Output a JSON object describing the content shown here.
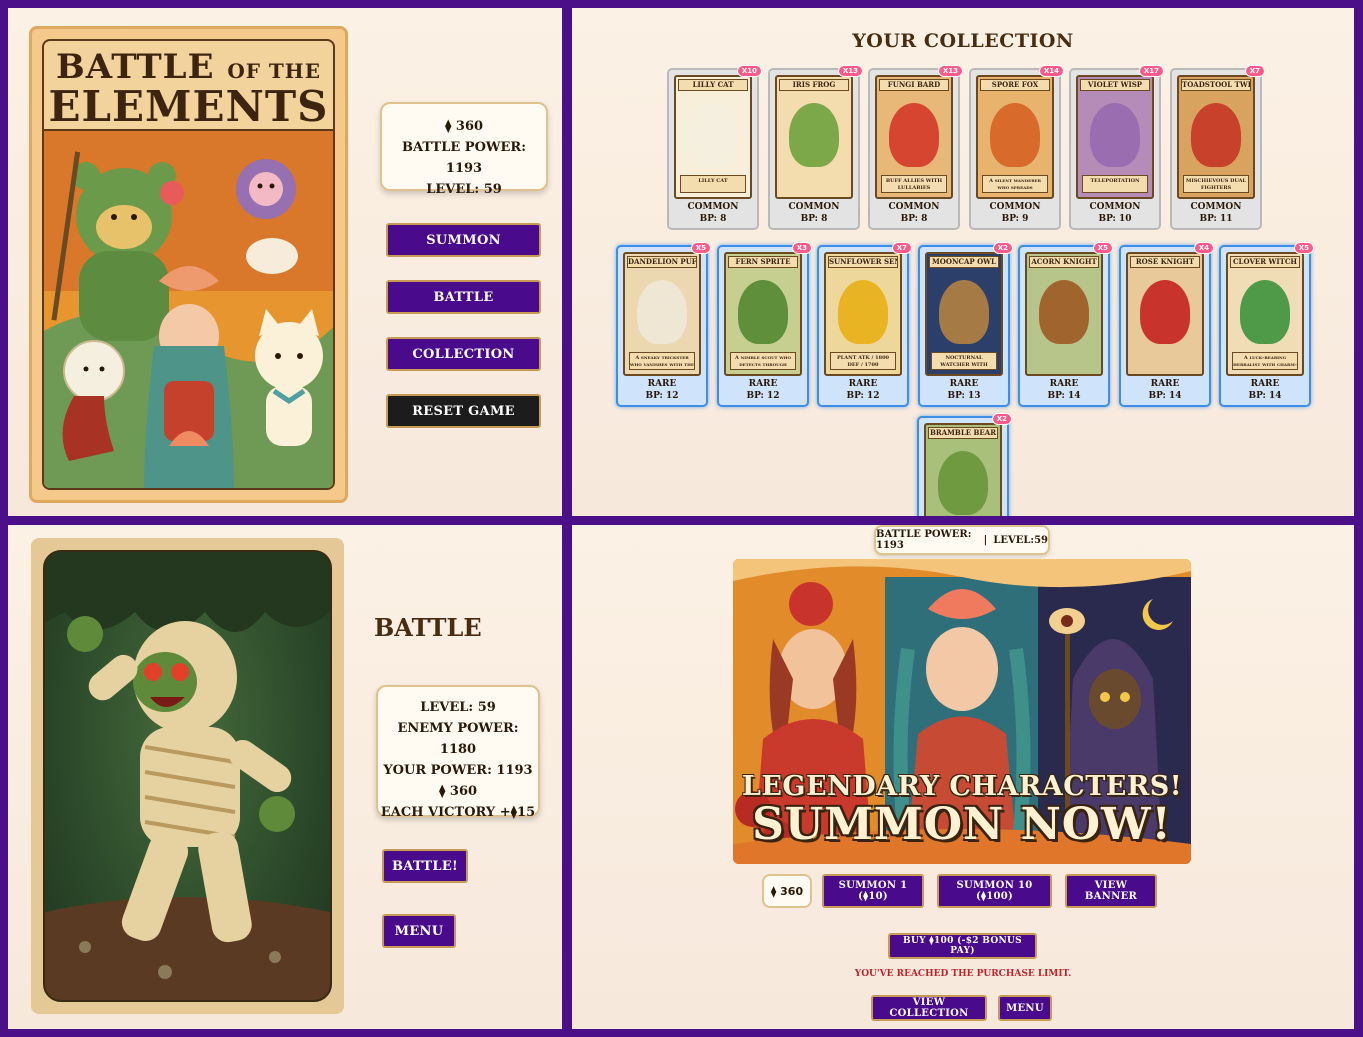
{
  "menu": {
    "title_line1": "BATTLE",
    "title_of_the": "OF THE",
    "title_line2": "ELEMENTS",
    "gems": "⧫ 360",
    "battle_power": "BATTLE POWER: 1193",
    "level": "LEVEL: 59",
    "buttons": {
      "summon": "SUMMON",
      "battle": "BATTLE",
      "collection": "COLLECTION",
      "reset": "RESET GAME"
    }
  },
  "collection": {
    "title": "YOUR COLLECTION",
    "cards": [
      {
        "name": "LILLY CAT",
        "rarity": "COMMON",
        "bp": "BP: 8",
        "count": "X10",
        "caption": "LILLY CAT",
        "color": "#f7efd9",
        "fig": "#f5efe0"
      },
      {
        "name": "IRIS FROG",
        "rarity": "COMMON",
        "bp": "BP: 8",
        "count": "X13",
        "caption": "",
        "color": "#f3dcae",
        "fig": "#7da84a"
      },
      {
        "name": "FUNGI BARD",
        "rarity": "COMMON",
        "bp": "BP: 8",
        "count": "X13",
        "caption": "BUFF ALLIES WITH LULLABIES",
        "color": "#e8b879",
        "fig": "#d6452f"
      },
      {
        "name": "SPORE FOX",
        "rarity": "COMMON",
        "bp": "BP: 9",
        "count": "X14",
        "caption": "A silent wanderer who spreads enchantment spores.",
        "color": "#e7b36d",
        "fig": "#d86b2c"
      },
      {
        "name": "VIOLET WISP",
        "rarity": "COMMON",
        "bp": "BP: 10",
        "count": "X17",
        "caption": "TELEPORTATION",
        "color": "#b58bb8",
        "fig": "#9a6db0"
      },
      {
        "name": "TOADSTOOL TWINS",
        "rarity": "COMMON",
        "bp": "BP: 11",
        "count": "X7",
        "caption": "MISCHIEVOUS DUAL FIGHTERS",
        "color": "#d8a35f",
        "fig": "#c8412b"
      },
      {
        "name": "DANDELION PUFF",
        "rarity": "RARE",
        "bp": "BP: 12",
        "count": "X5",
        "caption": "A sneaky trickster who vanishes with the wind.",
        "color": "#ecd8b0",
        "fig": "#efe6d4"
      },
      {
        "name": "FERN SPRITE",
        "rarity": "RARE",
        "bp": "BP: 12",
        "count": "X3",
        "caption": "A nimble scout who detects through underbrush.",
        "color": "#c6cf8f",
        "fig": "#5f8f3a"
      },
      {
        "name": "SUNFLOWER SENTRY",
        "rarity": "RARE",
        "bp": "BP: 12",
        "count": "X7",
        "caption": "PLANT  ATK / 1800  DEF / 1700",
        "color": "#eed79a",
        "fig": "#e8b424"
      },
      {
        "name": "MOONCAP OWL",
        "rarity": "RARE",
        "bp": "BP: 13",
        "count": "X2",
        "caption": "NOCTURNAL WATCHER WITH ILLUSION-BASED MAGIC",
        "color": "#2c3f6b",
        "fig": "#a57a44"
      },
      {
        "name": "ACORN KNIGHT",
        "rarity": "RARE",
        "bp": "BP: 14",
        "count": "X5",
        "caption": "",
        "color": "#b7c48a",
        "fig": "#a0652e"
      },
      {
        "name": "ROSE KNIGHT",
        "rarity": "RARE",
        "bp": "BP: 14",
        "count": "X4",
        "caption": "",
        "color": "#e7c99a",
        "fig": "#c8332b"
      },
      {
        "name": "CLOVER WITCH",
        "rarity": "RARE",
        "bp": "BP: 14",
        "count": "X5",
        "caption": "A luck-bearing herbalist with charm-based spells.",
        "color": "#f0dcb5",
        "fig": "#4f9a48"
      },
      {
        "name": "BRAMBLE BEAR",
        "rarity": "",
        "bp": "",
        "count": "X2",
        "caption": "",
        "color": "#a9c07a",
        "fig": "#6f9a3f"
      }
    ]
  },
  "battle": {
    "title": "BATTLE",
    "level": "LEVEL: 59",
    "enemy_power": "ENEMY POWER: 1180",
    "your_power": "YOUR POWER: 1193",
    "gems": "⧫ 360",
    "reward": "EACH VICTORY +⧫15",
    "battle_button": "BATTLE!",
    "menu_button": "MENU"
  },
  "summon": {
    "battle_power": "BATTLE POWER: 1193",
    "separator": "|",
    "level": "LEVEL:59",
    "banner_line1": "LEGENDARY CHARACTERS!",
    "banner_line2": "SUMMON NOW!",
    "gems": "⧫ 360",
    "summon1": "SUMMON 1 (⧫10)",
    "summon10": "SUMMON 10 (⧫100)",
    "view_banner": "VIEW BANNER",
    "buy": "BUY ⧫100 (-$2 BONUS PAY)",
    "limit_msg": "YOU'VE REACHED THE PURCHASE LIMIT.",
    "view_collection": "VIEW COLLECTION",
    "menu": "MENU"
  },
  "colors": {
    "frame": "#4b0f8a",
    "button": "#4a0a8c",
    "button_border": "#c79b55",
    "reset_button": "#1c1c1c",
    "rare_border": "#3d8ee8",
    "common_border": "#b9b9b9",
    "count_badge": "#ff5a8a",
    "warning": "#c0242b"
  }
}
